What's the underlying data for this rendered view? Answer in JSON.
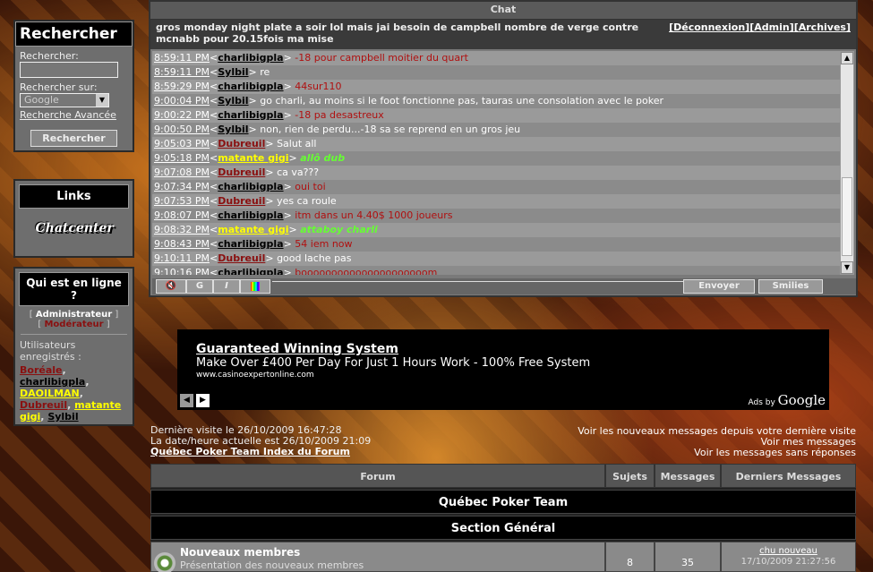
{
  "search": {
    "title": "Rechercher",
    "label_search": "Rechercher:",
    "label_on": "Rechercher sur:",
    "engine": "Google",
    "advanced": "Recherche Avancée",
    "button": "Rechercher"
  },
  "links": {
    "title": "Links",
    "logo_text": "Chatcenter"
  },
  "online": {
    "title": "Qui est en ligne ?",
    "role_admin": "Administrateur",
    "role_mod": "Modérateur",
    "registered_label": "Utilisateurs enregistrés :",
    "users": [
      {
        "name": "Boréale",
        "color": "#8a1010"
      },
      {
        "name": "charlibigpla",
        "color": "#000000"
      },
      {
        "name": "DAOILMAN",
        "color": "#ffff00"
      },
      {
        "name": "Dubreuil",
        "color": "#8a1010"
      },
      {
        "name": "matante gigi",
        "color": "#ffff00"
      },
      {
        "name": "Sylbil",
        "color": "#000000"
      }
    ]
  },
  "chat": {
    "header": "Chat",
    "topic": "gros monday night plate a soir lol mais jai besoin de campbell nombre de verge contre mcnabb pour 20.15fois ma mise",
    "topic_links": [
      "[Déconnexion]",
      "[Admin]",
      "[Archives]"
    ],
    "messages": [
      {
        "time": "8:59:11 PM",
        "nick": "charlibigpla",
        "nick_color": "#000000",
        "text": "-18 pour campbell moitier du quart",
        "text_color": "#b01010"
      },
      {
        "time": "8:59:11 PM",
        "nick": "Sylbil",
        "nick_color": "#000000",
        "text": "re",
        "text_color": "#ffffff"
      },
      {
        "time": "8:59:29 PM",
        "nick": "charlibigpla",
        "nick_color": "#000000",
        "text": "44sur110",
        "text_color": "#b01010"
      },
      {
        "time": "9:00:04 PM",
        "nick": "Sylbil",
        "nick_color": "#000000",
        "text": "go charli, au moins si le foot fonctionne pas, tauras une consolation avec le poker",
        "text_color": "#ffffff"
      },
      {
        "time": "9:00:22 PM",
        "nick": "charlibigpla",
        "nick_color": "#000000",
        "text": "-18 pa desastreux",
        "text_color": "#b01010"
      },
      {
        "time": "9:00:50 PM",
        "nick": "Sylbil",
        "nick_color": "#000000",
        "text": "non, rien de perdu...-18 sa se reprend en un gros jeu",
        "text_color": "#ffffff"
      },
      {
        "time": "9:05:03 PM",
        "nick": "Dubreuil",
        "nick_color": "#8a1010",
        "text": "Salut all",
        "text_color": "#ffffff"
      },
      {
        "time": "9:05:18 PM",
        "nick": "matante gigi",
        "nick_color": "#ffff00",
        "text": "allô dub",
        "text_color": "#66ff33"
      },
      {
        "time": "9:07:08 PM",
        "nick": "Dubreuil",
        "nick_color": "#8a1010",
        "text": "ca va???",
        "text_color": "#ffffff"
      },
      {
        "time": "9:07:34 PM",
        "nick": "charlibigpla",
        "nick_color": "#000000",
        "text": "oui toi",
        "text_color": "#b01010"
      },
      {
        "time": "9:07:53 PM",
        "nick": "Dubreuil",
        "nick_color": "#8a1010",
        "text": "yes ca roule",
        "text_color": "#ffffff"
      },
      {
        "time": "9:08:07 PM",
        "nick": "charlibigpla",
        "nick_color": "#000000",
        "text": "itm dans un 4.40$ 1000 joueurs",
        "text_color": "#b01010"
      },
      {
        "time": "9:08:32 PM",
        "nick": "matante gigi",
        "nick_color": "#ffff00",
        "text": "attaboy charli",
        "text_color": "#66ff33"
      },
      {
        "time": "9:08:43 PM",
        "nick": "charlibigpla",
        "nick_color": "#000000",
        "text": "54 iem now",
        "text_color": "#b01010"
      },
      {
        "time": "9:10:11 PM",
        "nick": "Dubreuil",
        "nick_color": "#8a1010",
        "text": "good lache pas",
        "text_color": "#ffffff"
      },
      {
        "time": "9:10:16 PM",
        "nick": "charlibigpla",
        "nick_color": "#000000",
        "text": "booooooooooooooooooooom",
        "text_color": "#b01010"
      }
    ],
    "tools": {
      "bold": "G",
      "italic": "I"
    },
    "send": "Envoyer",
    "smilies": "Smilies"
  },
  "ad": {
    "title": "Guaranteed Winning System",
    "text": "Make Over £400 Per Day For Just 1 Hours Work - 100% Free System",
    "url": "www.casinoexpertonline.com",
    "ads_by": "Ads by",
    "google": "Google"
  },
  "visit": {
    "last_visit": "Dernière visite le 26/10/2009 16:47:28",
    "current": "La date/heure actuelle est 26/10/2009 21:09",
    "index_link": "Québec Poker Team Index du Forum",
    "new_since": "Voir les nouveaux messages depuis votre dernière visite",
    "my_msgs": "Voir mes messages",
    "unanswered": "Voir les messages sans réponses"
  },
  "forum": {
    "headers": {
      "forum": "Forum",
      "topics": "Sujets",
      "posts": "Messages",
      "last": "Derniers Messages"
    },
    "category": "Québec Poker Team",
    "section": "Section Général",
    "rows": [
      {
        "name": "Nouveaux membres",
        "desc": "Présentation des nouveaux membres",
        "topics": "8",
        "posts": "35",
        "last_user": "chu nouveau",
        "last_date": "17/10/2009 21:27:56"
      }
    ]
  }
}
